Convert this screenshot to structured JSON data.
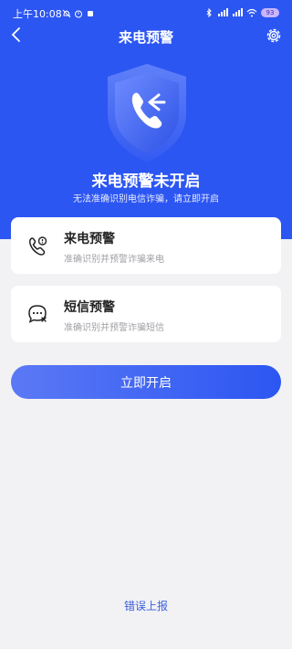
{
  "status_bar": {
    "time": "上午10:08",
    "battery": "93"
  },
  "header": {
    "title": "来电预警"
  },
  "hero": {
    "headline": "来电预警未开启",
    "subline": "无法准确识别电信诈骗，请立即开启"
  },
  "features": [
    {
      "title": "来电预警",
      "desc": "准确识别并预警诈骗来电",
      "icon": "phone-alert-icon"
    },
    {
      "title": "短信预警",
      "desc": "准确识别并预警诈骗短信",
      "icon": "sms-alert-icon"
    }
  ],
  "cta": {
    "label": "立即开启"
  },
  "footer": {
    "report": "错误上报"
  },
  "colors": {
    "primary": "#2c56f2",
    "background": "#f2f2f4",
    "link": "#3b5ed8"
  }
}
